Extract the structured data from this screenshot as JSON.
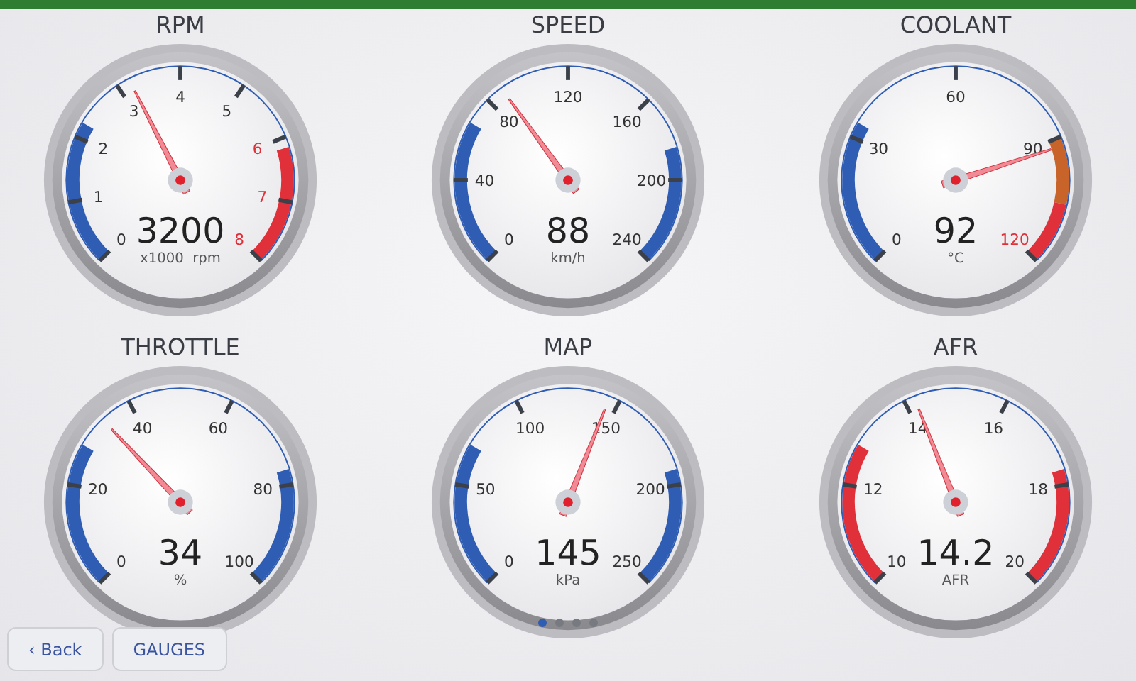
{
  "gauges": [
    {
      "title": "RPM",
      "value": "3200",
      "unit": "x1000  rpm",
      "level": 0.4,
      "labels": [
        {
          "text": "0",
          "color": "#333333"
        },
        {
          "text": "1",
          "color": "#333333"
        },
        {
          "text": "2",
          "color": "#333333"
        },
        {
          "text": "3",
          "color": "#333333"
        },
        {
          "text": "4",
          "color": "#333333"
        },
        {
          "text": "5",
          "color": "#333333"
        },
        {
          "text": "6",
          "color": "#e0303a"
        },
        {
          "text": "7",
          "color": "#e0303a"
        },
        {
          "text": "8",
          "color": "#e0303a"
        }
      ],
      "bands": [
        {
          "kind": "low",
          "color": "#2f5db4"
        },
        {
          "kind": "high",
          "color": "#e0303a"
        }
      ]
    },
    {
      "title": "SPEED",
      "value": "88",
      "unit": "km/h",
      "level": 0.367,
      "labels": [
        {
          "text": "0",
          "color": "#333333"
        },
        {
          "text": "40",
          "color": "#333333"
        },
        {
          "text": "80",
          "color": "#333333"
        },
        {
          "text": "120",
          "color": "#333333"
        },
        {
          "text": "160",
          "color": "#333333"
        },
        {
          "text": "200",
          "color": "#333333"
        },
        {
          "text": "240",
          "color": "#333333"
        }
      ],
      "bands": [
        {
          "kind": "low",
          "color": "#2f5db4"
        },
        {
          "kind": "high",
          "color": "#2f5db4"
        }
      ]
    },
    {
      "title": "COOLANT",
      "value": "92",
      "unit": "°C",
      "level": 0.767,
      "labels": [
        {
          "text": "0",
          "color": "#333333"
        },
        {
          "text": "30",
          "color": "#333333"
        },
        {
          "text": "60",
          "color": "#333333"
        },
        {
          "text": "90",
          "color": "#333333"
        },
        {
          "text": "120",
          "color": "#e0303a"
        }
      ],
      "bands": [
        {
          "kind": "low",
          "color": "#2f5db4"
        },
        {
          "kind": "warn",
          "color": "#c8642a"
        },
        {
          "kind": "danger",
          "color": "#e0303a"
        }
      ]
    },
    {
      "title": "THROTTLE",
      "value": "34",
      "unit": "%",
      "level": 0.34,
      "labels": [
        {
          "text": "0",
          "color": "#333333"
        },
        {
          "text": "20",
          "color": "#333333"
        },
        {
          "text": "40",
          "color": "#333333"
        },
        {
          "text": "60",
          "color": "#333333"
        },
        {
          "text": "80",
          "color": "#333333"
        },
        {
          "text": "100",
          "color": "#333333"
        }
      ],
      "bands": [
        {
          "kind": "low",
          "color": "#2f5db4"
        },
        {
          "kind": "high",
          "color": "#2f5db4"
        }
      ]
    },
    {
      "title": "MAP",
      "value": "145",
      "unit": "kPa",
      "level": 0.58,
      "labels": [
        {
          "text": "0",
          "color": "#333333"
        },
        {
          "text": "50",
          "color": "#333333"
        },
        {
          "text": "100",
          "color": "#333333"
        },
        {
          "text": "150",
          "color": "#333333"
        },
        {
          "text": "200",
          "color": "#333333"
        },
        {
          "text": "250",
          "color": "#333333"
        }
      ],
      "bands": [
        {
          "kind": "low",
          "color": "#2f5db4"
        },
        {
          "kind": "high",
          "color": "#2f5db4"
        }
      ],
      "page_dots": [
        {
          "selected": true
        },
        {
          "selected": false
        },
        {
          "selected": false
        },
        {
          "selected": false
        }
      ]
    },
    {
      "title": "AFR",
      "value": "14.2",
      "unit": "AFR",
      "level": 0.42,
      "labels": [
        {
          "text": "10",
          "color": "#333333"
        },
        {
          "text": "12",
          "color": "#333333"
        },
        {
          "text": "14",
          "color": "#333333"
        },
        {
          "text": "16",
          "color": "#333333"
        },
        {
          "text": "18",
          "color": "#333333"
        },
        {
          "text": "20",
          "color": "#333333"
        }
      ],
      "bands": [
        {
          "kind": "low",
          "color": "#e0303a"
        },
        {
          "kind": "high",
          "color": "#e0303a"
        }
      ]
    }
  ],
  "buttons": [
    {
      "label": "‹ Back"
    },
    {
      "label": "GAUGES"
    }
  ]
}
